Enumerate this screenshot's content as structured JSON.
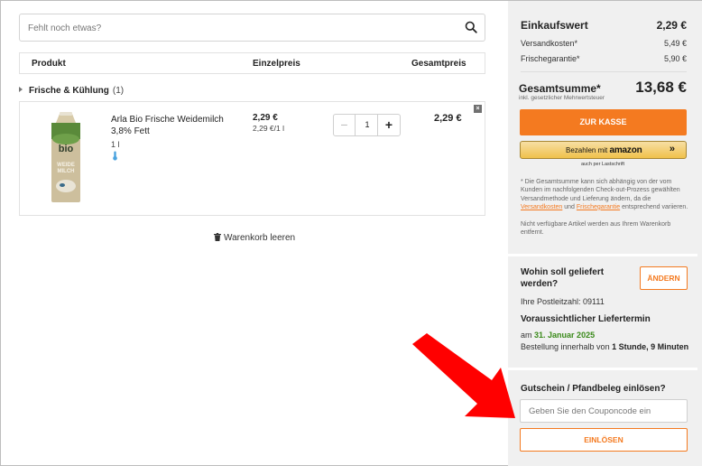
{
  "search": {
    "placeholder": "Fehlt noch etwas?"
  },
  "table": {
    "headers": {
      "product": "Produkt",
      "unit_price": "Einzelpreis",
      "total_price": "Gesamtpreis"
    }
  },
  "category": {
    "name": "Frische & Kühlung",
    "count": "(1)"
  },
  "item": {
    "name": "Arla Bio Frische Weidemilch 3,8% Fett",
    "unit": "1 l",
    "price": "2,29 €",
    "price_per_unit": "2,29 €/1 l",
    "quantity": "1",
    "minus": "−",
    "plus": "+",
    "total": "2,29 €",
    "remove": "×",
    "image_label_top": "bio",
    "image_label_mid": "WEIDE",
    "image_label_bottom": "MILCH"
  },
  "clear_cart": "Warenkorb leeren",
  "summary": {
    "title": "Einkaufswert",
    "value": "2,29 €",
    "rows": [
      {
        "label": "Versandkosten*",
        "value": "5,49 €"
      },
      {
        "label": "Frischegarantie*",
        "value": "5,90 €"
      }
    ],
    "total_label": "Gesamtsumme*",
    "total_sub": "inkl. gesetzlicher Mehrwertsteuer",
    "total_value": "13,68 €",
    "checkout": "ZUR KASSE",
    "amazon_pay_prefix": "Bezahlen mit",
    "amazon_pay_brand": "amazon",
    "amazon_pay_arrows": "»",
    "amazon_sub": "auch per Lastschrift",
    "note_part1": "* Die Gesamtsumme kann sich abhängig von der vom Kunden im nachfolgenden Check-out-Prozess gewählten Versandmethode und Lieferung ändern, da die",
    "note_link1": "Versandkosten",
    "note_and": "und",
    "note_link2": "Frischegarantie",
    "note_part2": "entsprechend variieren.",
    "note2": "Nicht verfügbare Artikel werden aus Ihrem Warenkorb entfernt."
  },
  "delivery": {
    "title": "Wohin soll geliefert werden?",
    "change": "ÄNDERN",
    "postcode": "Ihre Postleitzahl: 09111",
    "lt_title": "Voraussichtlicher Liefertermin",
    "date_prefix": "am",
    "date": "31. Januar 2025",
    "order_prefix": "Bestellung innerhalb von",
    "order_time": "1 Stunde, 9 Minuten"
  },
  "coupon": {
    "title": "Gutschein / Pfandbeleg einlösen?",
    "placeholder": "Geben Sie den Couponcode ein",
    "button": "EINLÖSEN"
  },
  "colors": {
    "accent": "#f47a20",
    "date_green": "#3a8a1a",
    "arrow": "#ff0000",
    "sidebar_bg": "#f0f0f0"
  }
}
